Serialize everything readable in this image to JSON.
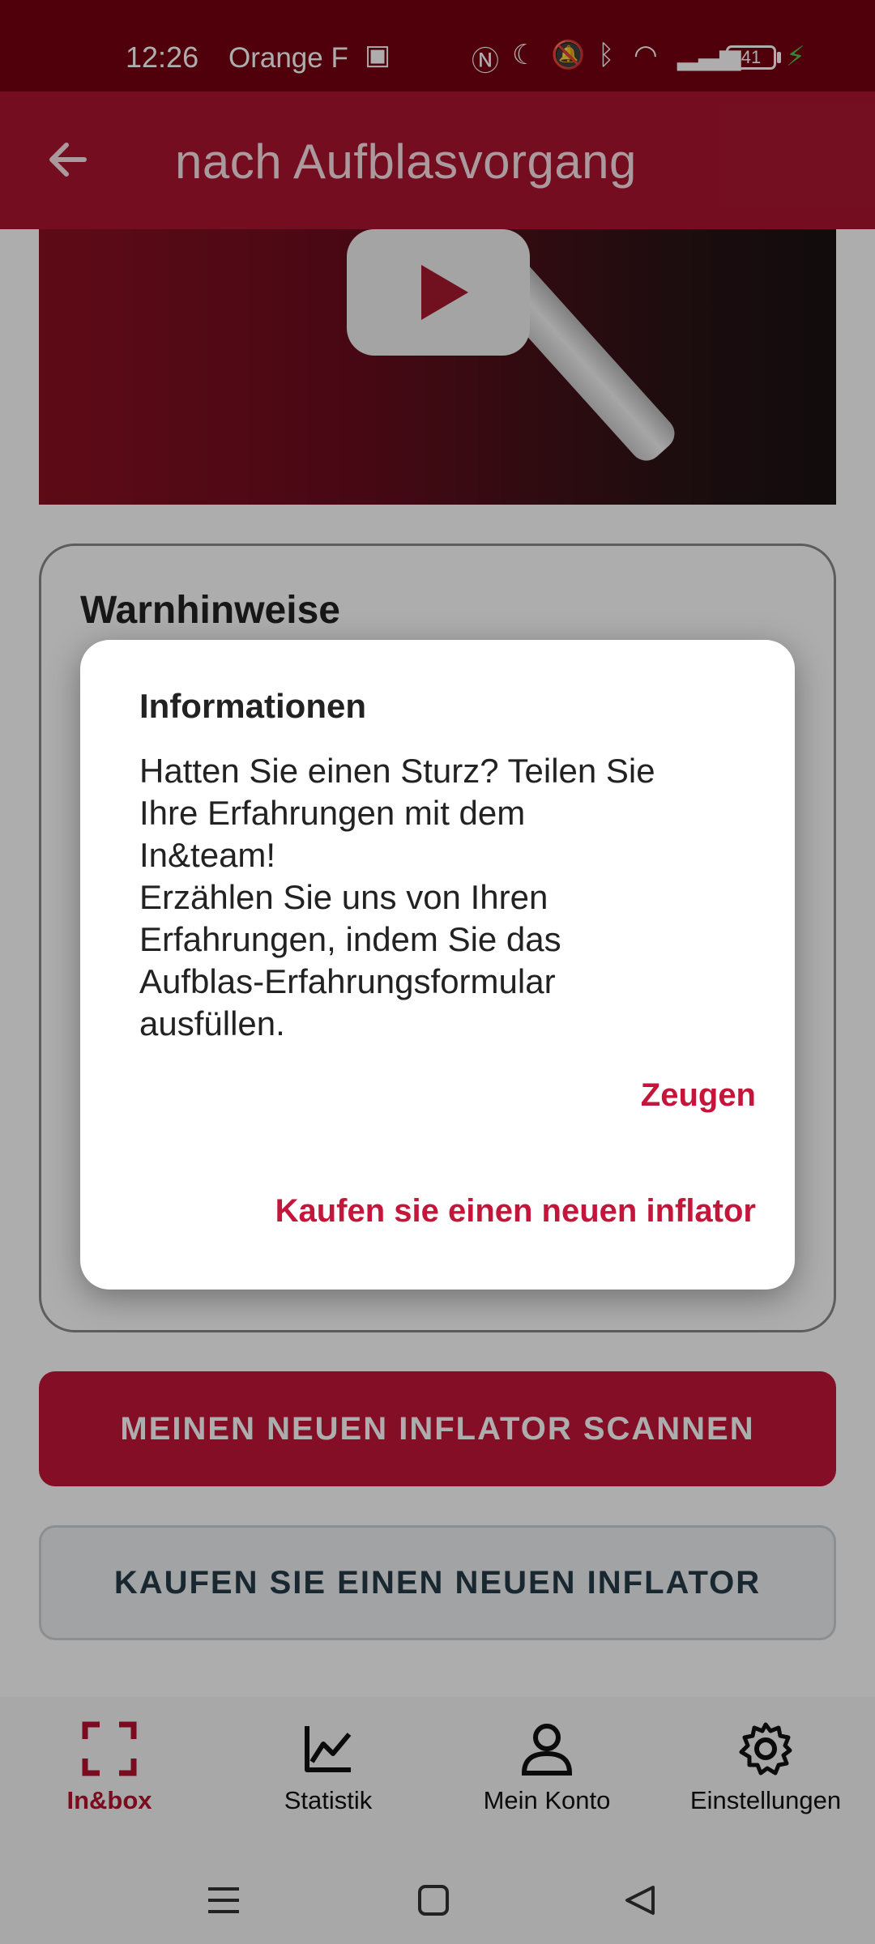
{
  "status_bar": {
    "time": "12:26",
    "carrier": "Orange F",
    "battery": "41"
  },
  "app_bar": {
    "title": "nach Aufblasvorgang"
  },
  "warnings_card": {
    "title": "Warnhinweise"
  },
  "buttons": {
    "scan": "MEINEN NEUEN INFLATOR SCANNEN",
    "buy": "KAUFEN SIE EINEN NEUEN INFLATOR"
  },
  "dialog": {
    "title": "Informationen",
    "body_lines": [
      "Hatten Sie einen Sturz? Teilen Sie",
      "Ihre Erfahrungen mit dem",
      "In&team!",
      "Erzählen Sie uns von Ihren",
      "Erfahrungen, indem Sie das",
      "Aufblas-Erfahrungsformular",
      "ausfüllen."
    ],
    "show_button": "Zeugen",
    "buy_button": "Kaufen sie einen neuen inflator"
  },
  "bottom_nav": {
    "items": [
      {
        "label": "In&box",
        "icon": "scan-frame-icon",
        "active": true
      },
      {
        "label": "Statistik",
        "icon": "chart-icon",
        "active": false
      },
      {
        "label": "Mein Konto",
        "icon": "person-icon",
        "active": false
      },
      {
        "label": "Einstellungen",
        "icon": "gear-icon",
        "active": false
      }
    ]
  },
  "colors": {
    "status_bar": "#76000f",
    "app_bar": "#ab1430",
    "accent": "#c4153a"
  }
}
